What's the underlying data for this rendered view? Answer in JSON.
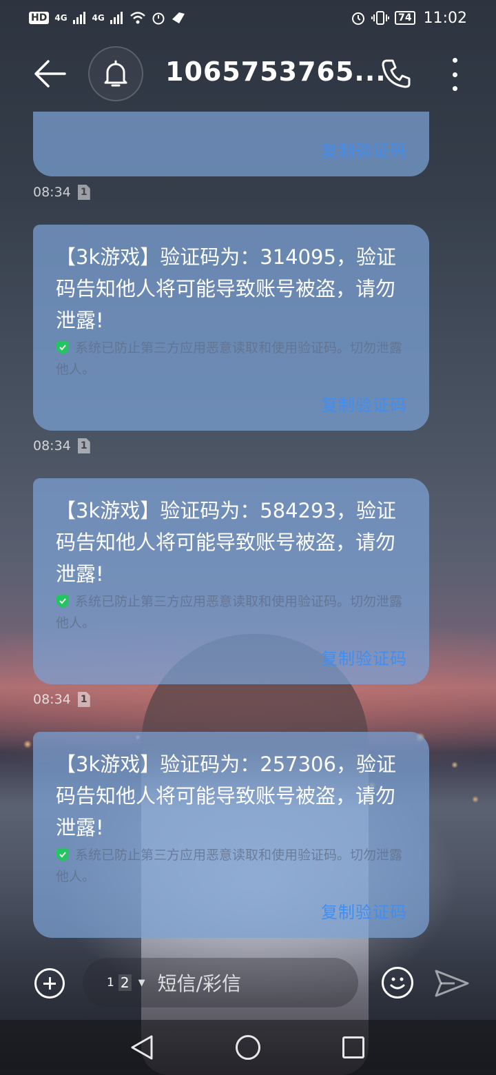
{
  "status_bar": {
    "hd_label": "HD",
    "signal1": "4G",
    "signal2": "4G",
    "battery": "74",
    "time": "11:02"
  },
  "header": {
    "title": "1065753765..."
  },
  "messages": [
    {
      "text": "",
      "note": "",
      "copy_label": "复制验证码",
      "time": "08:34",
      "sim": "1"
    },
    {
      "text": "【3k游戏】验证码为：314095，验证码告知他人将可能导致账号被盗，请勿泄露!",
      "note": "系统已防止第三方应用恶意读取和使用验证码。切勿泄露他人。",
      "copy_label": "复制验证码",
      "time": "08:34",
      "sim": "1"
    },
    {
      "text": "【3k游戏】验证码为：584293，验证码告知他人将可能导致账号被盗，请勿泄露!",
      "note": "系统已防止第三方应用恶意读取和使用验证码。切勿泄露他人。",
      "copy_label": "复制验证码",
      "time": "08:34",
      "sim": "1"
    },
    {
      "text": "【3k游戏】验证码为：257306，验证码告知他人将可能导致账号被盗，请勿泄露!",
      "note": "系统已防止第三方应用恶意读取和使用验证码。切勿泄露他人。",
      "copy_label": "复制验证码"
    }
  ],
  "composer": {
    "sim_top": "1",
    "sim_bottom": "2",
    "placeholder": "短信/彩信"
  },
  "colors": {
    "bubble": "#7CA2D6",
    "copy_link": "#3F8EF0",
    "shield": "#22C55E"
  }
}
